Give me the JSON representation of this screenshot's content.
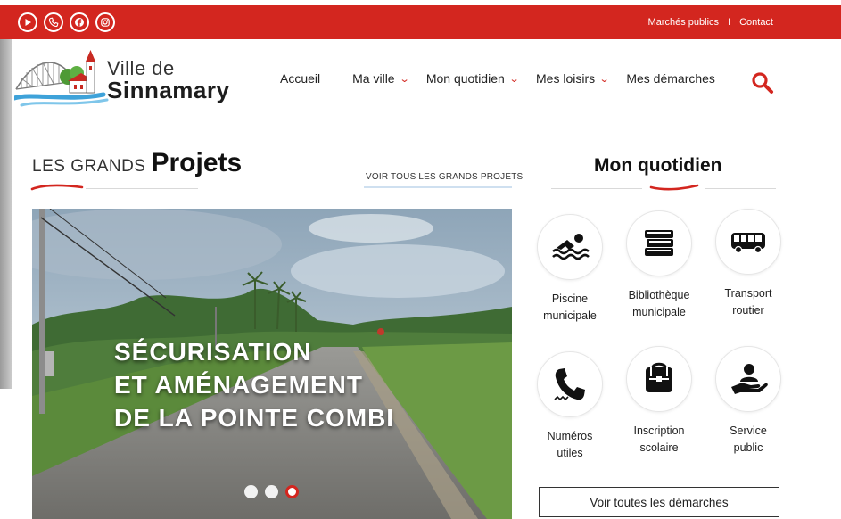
{
  "topbar": {
    "social": [
      {
        "icon": "youtube-icon"
      },
      {
        "icon": "phone-icon"
      },
      {
        "icon": "facebook-icon"
      },
      {
        "icon": "instagram-icon"
      }
    ],
    "links": [
      "Marchés publics",
      "Contact"
    ],
    "separator": "I"
  },
  "header": {
    "logo_line1": "Ville de",
    "logo_line2": "Sinnamary",
    "nav": [
      "Accueil",
      "Ma ville",
      "Mon quotidien",
      "Mes loisirs",
      "Mes démarches"
    ]
  },
  "projets": {
    "title_pre": "LES GRANDS",
    "title_main": "Projets",
    "voir_tous": "VOIR TOUS LES GRANDS PROJETS",
    "slide": {
      "lines": [
        "SÉCURISATION",
        "ET AMÉNAGEMENT",
        "DE LA POINTE COMBI"
      ],
      "dot_count": 3,
      "active_dot": 3
    }
  },
  "quotidien": {
    "title": "Mon quotidien",
    "services": [
      {
        "line1": "Piscine",
        "line2": "municipale",
        "icon": "swimming-icon"
      },
      {
        "line1": "Bibliothèque",
        "line2": "municipale",
        "icon": "books-icon"
      },
      {
        "line1": "Transport",
        "line2": "routier",
        "icon": "bus-icon"
      },
      {
        "line1": "Numéros",
        "line2": "utiles",
        "icon": "phone-icon"
      },
      {
        "line1": "Inscription",
        "line2": "scolaire",
        "icon": "schoolbag-icon"
      },
      {
        "line1": "Service",
        "line2": "public",
        "icon": "hand-user-icon"
      }
    ],
    "button": "Voir toutes les démarches"
  },
  "colors": {
    "brand_red": "#d3261f"
  }
}
